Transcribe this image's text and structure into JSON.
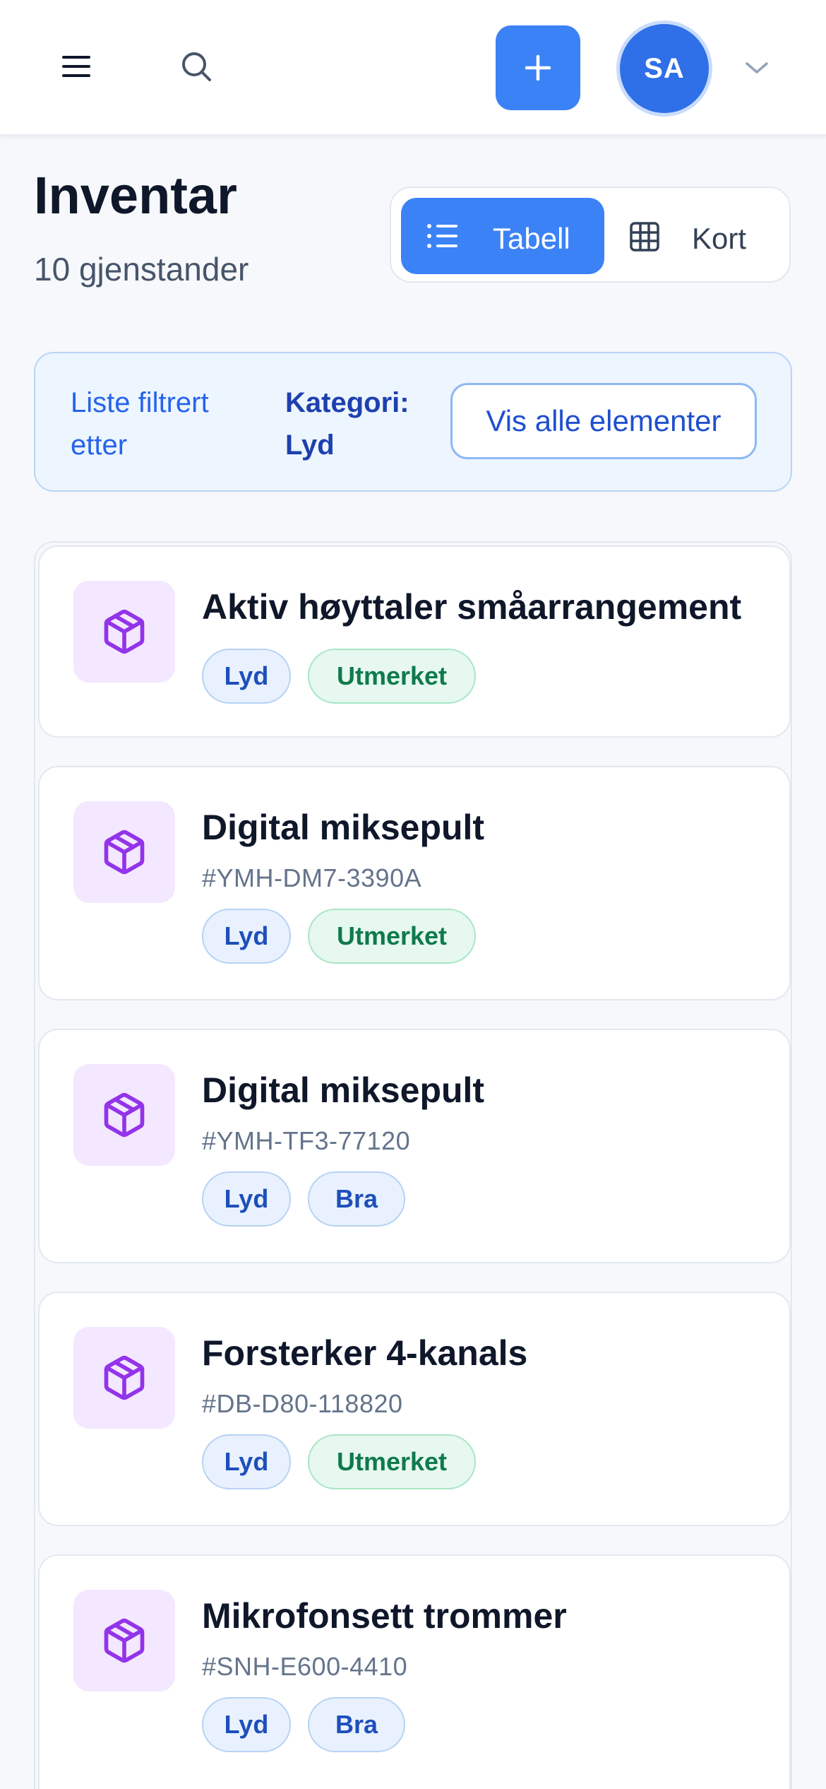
{
  "topbar": {
    "menu_icon": "menu-icon",
    "search_icon": "search-icon",
    "add_icon": "plus-icon",
    "avatar_initials": "SA",
    "caret_icon": "chevron-down-icon"
  },
  "header": {
    "title": "Inventar",
    "count": "10 gjenstander"
  },
  "view_toggle": {
    "table_label": "Tabell",
    "card_label": "Kort",
    "active": "Tabell"
  },
  "filter": {
    "text": "Liste filtrert etter",
    "key": "Kategori: Lyd",
    "button": "Vis alle elementer"
  },
  "colors": {
    "accent": "#3b82f6",
    "thumb_bg": "#f3e8ff",
    "icon": "#9333ea",
    "chip_blue": "#e8f1fd",
    "chip_green": "#e6f8ef"
  },
  "items": [
    {
      "title": "Aktiv høyttaler småarrangement",
      "code": "",
      "category": "Lyd",
      "condition": "Utmerket",
      "condition_style": "green"
    },
    {
      "title": "Digital miksepult",
      "code": "#YMH-DM7-3390A",
      "category": "Lyd",
      "condition": "Utmerket",
      "condition_style": "green"
    },
    {
      "title": "Digital miksepult",
      "code": "#YMH-TF3-77120",
      "category": "Lyd",
      "condition": "Bra",
      "condition_style": "blue"
    },
    {
      "title": "Forsterker 4-kanals",
      "code": "#DB-D80-118820",
      "category": "Lyd",
      "condition": "Utmerket",
      "condition_style": "green"
    },
    {
      "title": "Mikrofonsett trommer",
      "code": "#SNH-E600-4410",
      "category": "Lyd",
      "condition": "Bra",
      "condition_style": "blue"
    }
  ]
}
